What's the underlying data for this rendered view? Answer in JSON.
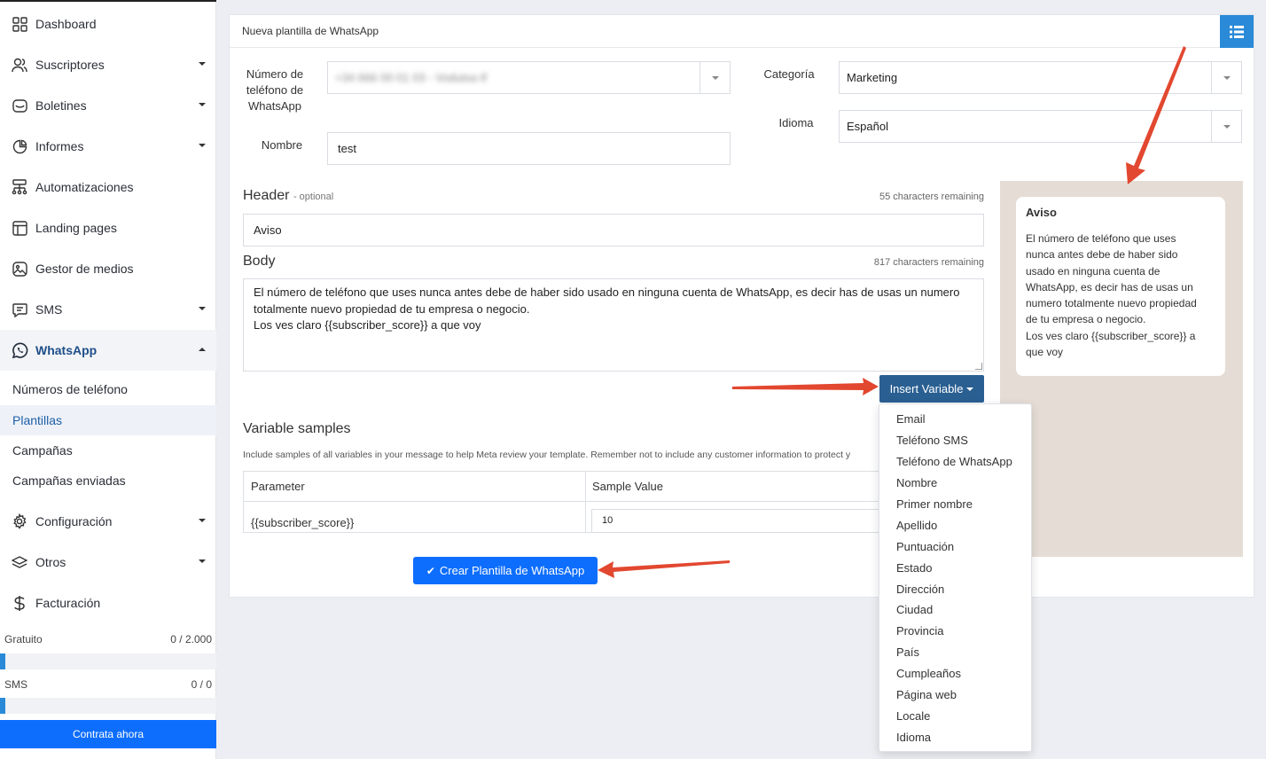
{
  "sidebar": {
    "nav": [
      {
        "label": "Dashboard",
        "icon": "dashboard-icon"
      },
      {
        "label": "Suscriptores",
        "icon": "users-icon"
      },
      {
        "label": "Boletines",
        "icon": "inbox-icon"
      },
      {
        "label": "Informes",
        "icon": "pie-chart-icon"
      },
      {
        "label": "Automatizaciones",
        "icon": "flow-icon"
      },
      {
        "label": "Landing pages",
        "icon": "layout-icon"
      },
      {
        "label": "Gestor de medios",
        "icon": "image-icon"
      },
      {
        "label": "SMS",
        "icon": "message-icon"
      },
      {
        "label": "WhatsApp",
        "icon": "whatsapp-icon"
      },
      {
        "label": "Configuración",
        "icon": "gear-icon"
      },
      {
        "label": "Otros",
        "icon": "layers-icon"
      },
      {
        "label": "Facturación",
        "icon": "dollar-icon"
      }
    ],
    "whatsapp_sub": [
      {
        "label": "Números de teléfono"
      },
      {
        "label": "Plantillas"
      },
      {
        "label": "Campañas"
      },
      {
        "label": "Campañas enviadas"
      }
    ],
    "usage": [
      {
        "label": "Gratuito",
        "value": "0 / 2.000"
      },
      {
        "label": "SMS",
        "value": "0 / 0"
      }
    ],
    "cta_label": "Contrata ahora"
  },
  "form": {
    "title": "Nueva plantilla de WhatsApp",
    "phone_label": "Número de teléfono de WhatsApp",
    "phone_value": "+34 666 00 01 03 - Vodutsa tf",
    "name_label": "Nombre",
    "name_value": "test",
    "category_label": "Categoría",
    "category_value": "Marketing",
    "language_label": "Idioma",
    "language_value": "Español",
    "header_title": "Header",
    "header_optional": "- optional",
    "header_remaining": "55 characters remaining",
    "header_value": "Aviso",
    "body_title": "Body",
    "body_remaining": "817 characters remaining",
    "body_value": "El número de teléfono que uses nunca antes debe de haber sido usado en ninguna cuenta de WhatsApp, es decir has de usas un numero totalmente nuevo propiedad de tu empresa o negocio.\nLos ves claro {{subscriber_score}} a que voy",
    "insert_variable_label": "Insert Variable",
    "variable_samples_title": "Variable samples",
    "variable_samples_desc": "Include samples of all variables in your message to help Meta review your template. Remember not to include any customer information to protect y",
    "table": {
      "headers": [
        "Parameter",
        "Sample Value"
      ],
      "rows": [
        {
          "parameter": "{{subscriber_score}}",
          "sample": "10"
        }
      ]
    },
    "submit_label": "Crear Plantilla de WhatsApp"
  },
  "preview": {
    "title": "Aviso",
    "body": "El número de teléfono que uses\nnunca antes debe de haber sido\nusado en ninguna cuenta de\nWhatsApp, es decir has de usas un\nnumero totalmente nuevo propiedad\nde tu empresa o negocio.\nLos ves claro {{subscriber_score}} a\nque voy"
  },
  "variable_menu": [
    "Email",
    "Teléfono SMS",
    "Teléfono de WhatsApp",
    "Nombre",
    "Primer nombre",
    "Apellido",
    "Puntuación",
    "Estado",
    "Dirección",
    "Ciudad",
    "Provincia",
    "País",
    "Cumpleaños",
    "Página web",
    "Locale",
    "Idioma"
  ],
  "colors": {
    "accent": "#0d6efd",
    "active_nav": "#1d4e89",
    "insert_button": "#2a5f92",
    "annotation_arrow": "#e2472f",
    "preview_bg": "#e5ddd5"
  }
}
